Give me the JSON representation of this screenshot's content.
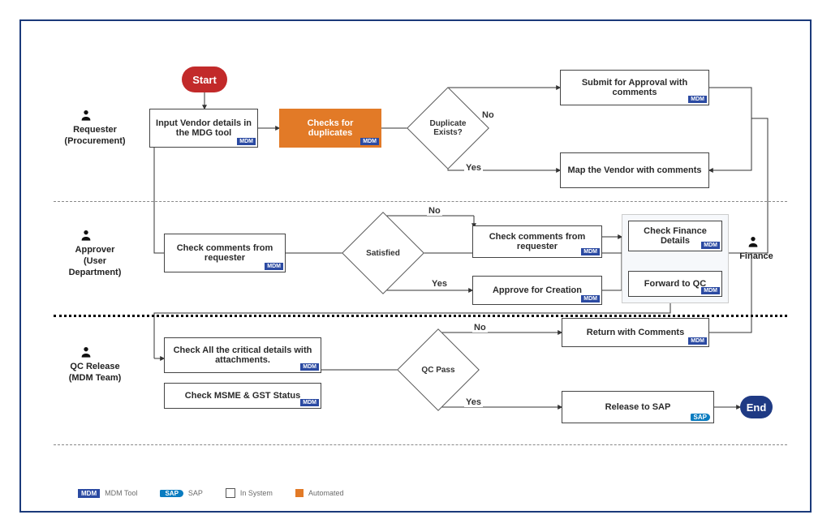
{
  "lanes": {
    "requester": {
      "label": "Requester\n(Procurement)"
    },
    "approver": {
      "label": "Approver\n(User Department)"
    },
    "qc": {
      "label": "QC Release\n(MDM Team)"
    },
    "finance": {
      "label": "Finance"
    }
  },
  "terminals": {
    "start": "Start",
    "end": "End"
  },
  "boxes": {
    "input_vendor": "Input Vendor details in the MDG tool",
    "check_dup": "Checks for duplicates",
    "submit_appr": "Submit for Approval with comments",
    "map_vendor": "Map the Vendor with comments",
    "check_cmts_req": "Check comments from requester",
    "check_cmts_req2": "Check comments from requester",
    "approve_create": "Approve for Creation",
    "check_fin": "Check Finance Details",
    "fwd_qc": "Forward to QC",
    "check_crit": "Check All the critical details with attachments.",
    "check_msme": "Check MSME & GST Status",
    "return_cmts": "Return with Comments",
    "release_sap": "Release to SAP"
  },
  "decisions": {
    "dup_exists": "Duplicate Exists?",
    "satisfied": "Satisfied",
    "qc_pass": "QC Pass"
  },
  "edges": {
    "yes": "Yes",
    "no": "No"
  },
  "legend": {
    "mdm_badge": "MDM",
    "mdm": "MDM Tool",
    "sap_badge": "SAP",
    "sap": "SAP",
    "insys": "In System",
    "auto": "Automated"
  },
  "badge": {
    "mdm": "MDM",
    "sap": "SAP"
  }
}
